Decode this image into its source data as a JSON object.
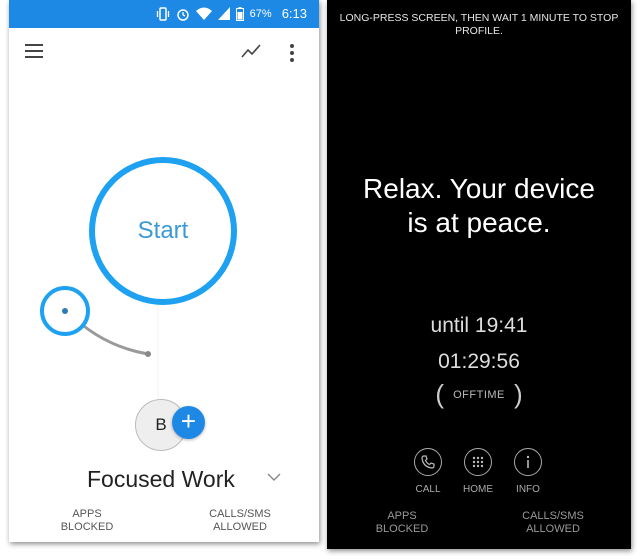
{
  "colors": {
    "accent": "#1ea1f1",
    "status_bar": "#1e88e5",
    "dark_bg": "#000000"
  },
  "left": {
    "status_bar": {
      "battery_percent": "67%",
      "time": "6:13",
      "icons": [
        "vibrate-icon",
        "alarm-icon",
        "wifi-icon",
        "signal-icon",
        "battery-icon"
      ]
    },
    "toolbar": {
      "menu_icon": "hamburger-menu-icon",
      "stats_icon": "trend-line-icon",
      "more_icon": "more-vert-icon"
    },
    "main": {
      "start_label": "Start",
      "profile_initial": "B",
      "add_label": "+",
      "profile_name": "Focused Work"
    },
    "footer": {
      "apps_blocked": [
        "APPS",
        "BLOCKED"
      ],
      "calls_allowed": [
        "CALLS/SMS",
        "ALLOWED"
      ]
    }
  },
  "right": {
    "hint": "LONG-PRESS SCREEN, THEN WAIT 1 MINUTE TO STOP PROFILE.",
    "message": "Relax. Your device is at peace.",
    "until": "until 19:41",
    "timer": "01:29:56",
    "badge": {
      "open": "(",
      "text": "OFFTIME",
      "close": ")"
    },
    "actions": [
      {
        "label": "CALL",
        "icon": "phone-icon"
      },
      {
        "label": "HOME",
        "icon": "apps-grid-icon"
      },
      {
        "label": "INFO",
        "icon": "info-icon"
      }
    ],
    "footer": {
      "apps_blocked": [
        "APPS",
        "BLOCKED"
      ],
      "calls_allowed": [
        "CALLS/SMS",
        "ALLOWED"
      ]
    }
  }
}
